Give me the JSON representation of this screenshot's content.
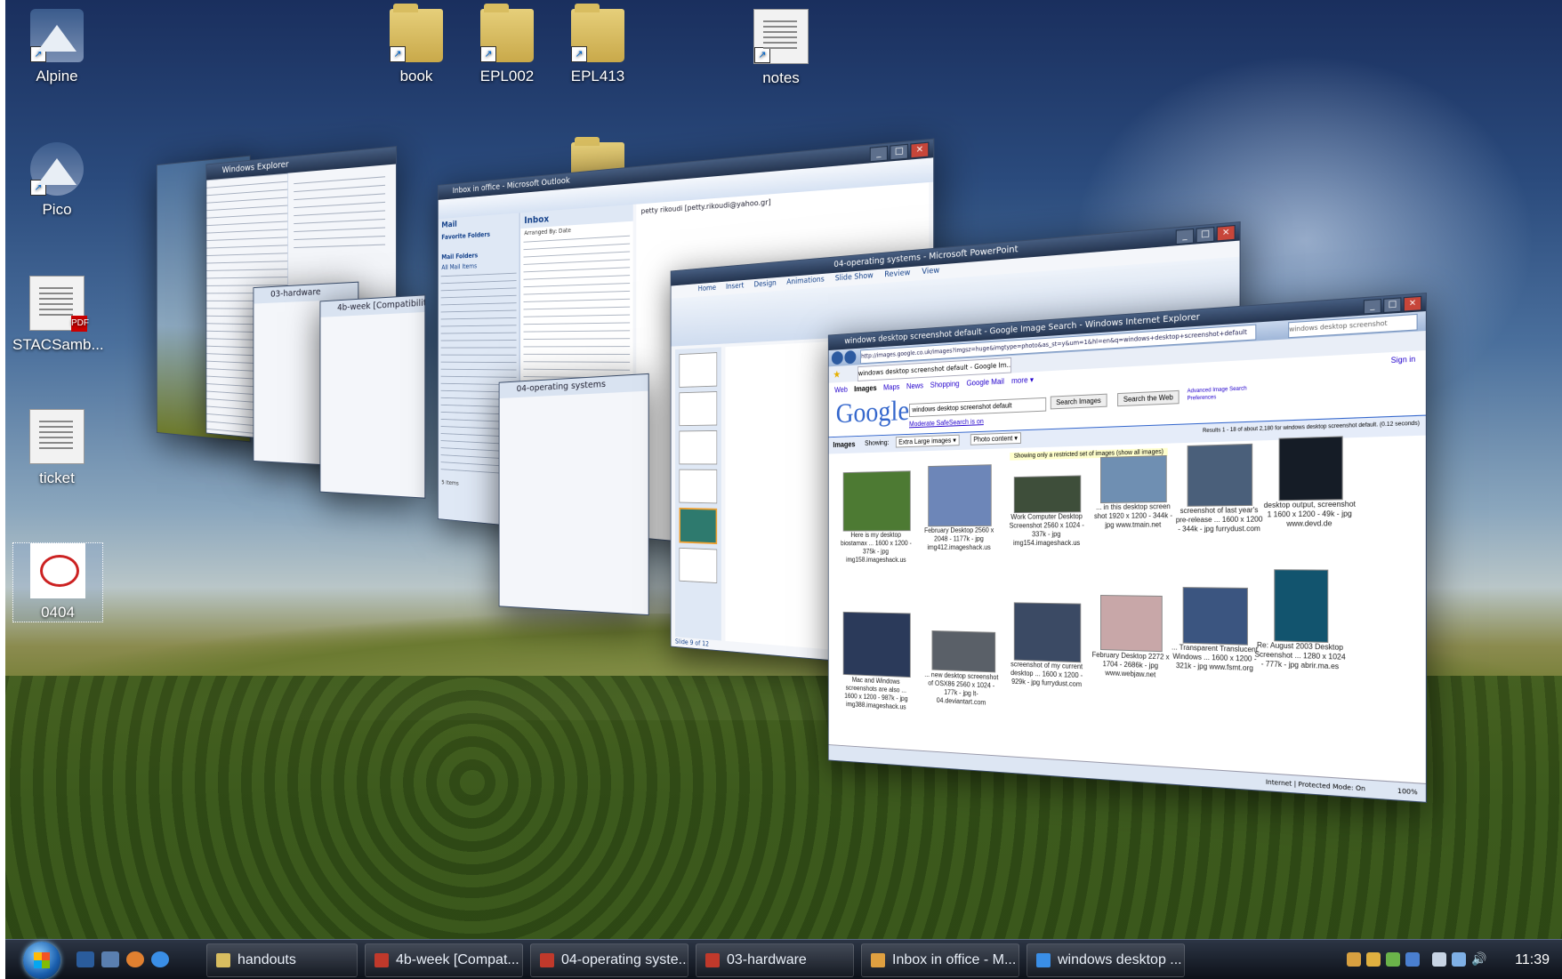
{
  "desktop": {
    "icons": [
      {
        "label": "Alpine",
        "icon": "mountain-shortcut-icon"
      },
      {
        "label": "Pico",
        "icon": "mountain-shortcut-icon"
      },
      {
        "label": "STACSamb...",
        "icon": "pdf-document-icon"
      },
      {
        "label": "ticket",
        "icon": "document-icon"
      },
      {
        "label": "0404",
        "icon": "red-symbol-icon"
      },
      {
        "label": "book",
        "icon": "folder-shortcut-icon"
      },
      {
        "label": "EPL002",
        "icon": "folder-shortcut-icon"
      },
      {
        "label": "EPL413",
        "icon": "folder-shortcut-icon"
      },
      {
        "label": "notes",
        "icon": "text-file-shortcut-icon"
      }
    ]
  },
  "flip3d": {
    "explorer": {
      "title": "Windows Explorer"
    },
    "outlook": {
      "title": "Inbox in office - Microsoft Outlook",
      "nav_header": "Mail",
      "favorite_folders": "Favorite Folders",
      "mail_folders": "Mail Folders",
      "all_mail": "All Mail Items",
      "inbox_header": "Inbox",
      "arranged": "Arranged By: Date",
      "preview_from": "petty rikoudi [petty.rikoudi@yahoo.gr]",
      "items_count": "5 Items"
    },
    "word1": {
      "title": "03-hardware"
    },
    "word2": {
      "title": "4b-week [Compatibilit..."
    },
    "word3": {
      "title": "04-operating systems"
    },
    "powerpoint": {
      "title": "04-operating systems - Microsoft PowerPoint",
      "tabs": [
        "Home",
        "Insert",
        "Design",
        "Animations",
        "Slide Show",
        "Review",
        "View"
      ],
      "status": "Slide 9 of 12"
    },
    "ie": {
      "title": "windows desktop screenshot default - Google Image Search - Windows Internet Explorer",
      "url": "http://images.google.co.uk/images?imgsz=huge&imgtype=photo&as_st=y&um=1&hl=en&q=windows+desktop+screenshot+default",
      "tab_label": "windows desktop screenshot default - Google Im...",
      "search_box": "windows desktop screenshot",
      "google_nav": [
        "Web",
        "Images",
        "Maps",
        "News",
        "Shopping",
        "Google Mail",
        "more ▾"
      ],
      "sign_in": "Sign in",
      "logo": "Google",
      "query": "windows desktop screenshot default",
      "search_images_btn": "Search Images",
      "search_web_btn": "Search the Web",
      "advanced": "Advanced Image Search",
      "preferences": "Preferences",
      "safesearch": "Moderate SafeSearch is on",
      "images_label": "Images",
      "showing_label": "Showing:",
      "size_filter": "Extra Large images ▾",
      "content_filter": "Photo content ▾",
      "results": "Results 1 - 18 of about 2,180 for windows desktop screenshot default. (0.12 seconds)",
      "restricted_note": "Showing only a restricted set of images (show all images)",
      "thumbs": [
        {
          "caption": "Here is my desktop biostamax ... 1600 x 1200 - 375k - jpg img158.imageshack.us",
          "color": "#4d7a33"
        },
        {
          "caption": "February Desktop 2560 x 2048 - 1177k - jpg img412.imageshack.us",
          "color": "#6d86b8"
        },
        {
          "caption": "Work Computer Desktop Screenshot 2560 x 1024 - 337k - jpg img154.imageshack.us",
          "color": "#3e4e3a"
        },
        {
          "caption": "... in this desktop screen shot 1920 x 1200 - 344k - jpg www.tmain.net",
          "color": "#6f8fb2"
        },
        {
          "caption": "screenshot of last year's pre-release ... 1600 x 1200 - 344k - jpg furrydust.com",
          "color": "#4a5f7a"
        },
        {
          "caption": "desktop output, screenshot 1 1600 x 1200 - 49k - jpg www.devd.de",
          "color": "#151c26"
        },
        {
          "caption": "Mac and Windows screenshots are also ... 1600 x 1200 - 987k - jpg img388.imageshack.us",
          "color": "#2b3a5a"
        },
        {
          "caption": "... new desktop screenshot of OSX86 2560 x 1024 - 177k - jpg lt-04.deviantart.com",
          "color": "#5a6068"
        },
        {
          "caption": "screenshot of my current desktop ... 1600 x 1200 - 929k - jpg furrydust.com",
          "color": "#3b4a64"
        },
        {
          "caption": "February Desktop 2272 x 1704 - 2686k - jpg www.webjaw.net",
          "color": "#c8a7a8"
        },
        {
          "caption": "... Transparent Translucent Windows ... 1600 x 1200 - 321k - jpg www.fsmt.org",
          "color": "#3b5580"
        },
        {
          "caption": "Re: August 2003 Desktop Screenshot ... 1280 x 1024 - 777k - jpg abrir.ma.es",
          "color": "#12546e"
        }
      ],
      "statusbar_zone": "Internet | Protected Mode: On",
      "zoom": "100%"
    }
  },
  "taskbar": {
    "buttons": [
      {
        "label": "handouts",
        "icon": "folder-icon",
        "color": "#d8bd60"
      },
      {
        "label": "4b-week [Compat...",
        "icon": "word-doc-icon",
        "color": "#c0392b"
      },
      {
        "label": "04-operating syste...",
        "icon": "powerpoint-icon",
        "color": "#c0392b"
      },
      {
        "label": "03-hardware",
        "icon": "word-doc-icon",
        "color": "#c0392b"
      },
      {
        "label": "Inbox in office - M...",
        "icon": "outlook-icon",
        "color": "#e0a040"
      },
      {
        "label": "windows desktop ...",
        "icon": "ie-icon",
        "color": "#3a8ee6"
      }
    ],
    "clock": "11:39"
  }
}
